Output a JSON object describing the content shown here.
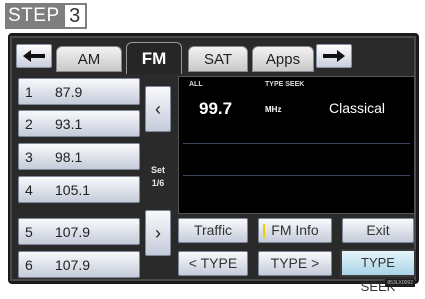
{
  "step": {
    "label": "STEP",
    "number": "3"
  },
  "tabs": {
    "back_icon": "left-arrow-icon",
    "forward_icon": "right-arrow-icon",
    "items": [
      {
        "label": "AM",
        "active": false
      },
      {
        "label": "FM",
        "active": true
      },
      {
        "label": "SAT",
        "active": false
      },
      {
        "label": "Apps",
        "active": false
      }
    ]
  },
  "presets": [
    {
      "num": "1",
      "freq": "87.9"
    },
    {
      "num": "2",
      "freq": "93.1"
    },
    {
      "num": "3",
      "freq": "98.1"
    },
    {
      "num": "4",
      "freq": "105.1"
    },
    {
      "num": "5",
      "freq": "107.9"
    },
    {
      "num": "6",
      "freq": "107.9"
    }
  ],
  "preset_nav": {
    "prev": "‹",
    "next": "›",
    "set_label": "Set",
    "set_page": "1/6"
  },
  "station": {
    "band_label": "ALL",
    "mode_label": "TYPE SEEK",
    "frequency": "99.7",
    "unit": "MHz",
    "genre": "Classical"
  },
  "functions": {
    "traffic": "Traffic",
    "fm_info": "FM Info",
    "exit": "Exit",
    "type_prev": "< TYPE",
    "type_next": "TYPE >",
    "type_seek": "TYPE SEEK"
  },
  "image_code": "853LX0092"
}
